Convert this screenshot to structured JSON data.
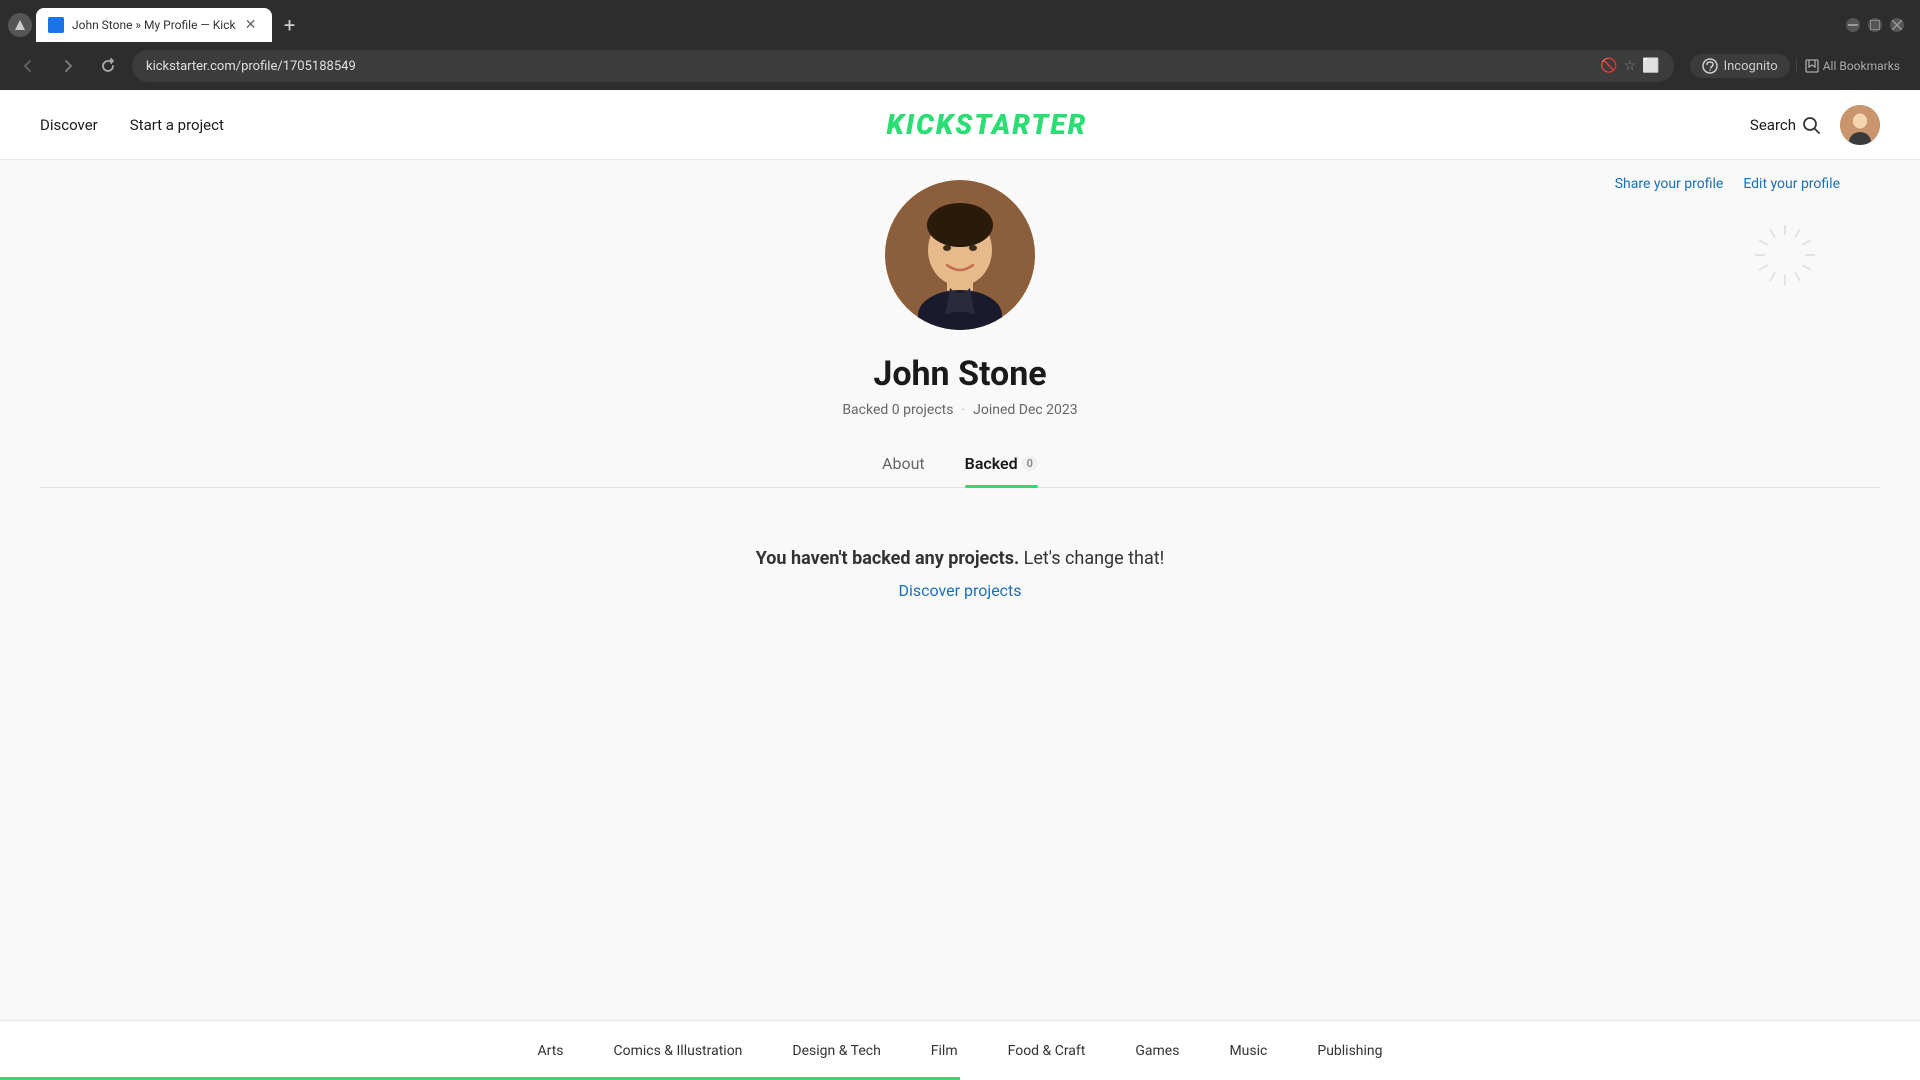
{
  "browser": {
    "tab_title": "John Stone » My Profile — Kick",
    "url": "kickstarter.com/profile/1705188549",
    "new_tab_label": "+",
    "incognito_label": "Incognito",
    "all_bookmarks_label": "All Bookmarks"
  },
  "nav": {
    "discover_label": "Discover",
    "start_project_label": "Start a project",
    "logo_text": "KICKSTARTER",
    "search_label": "Search"
  },
  "profile": {
    "name": "John Stone",
    "meta_backed": "Backed 0 projects",
    "meta_dot": "·",
    "meta_joined": "Joined Dec 2023",
    "share_label": "Share your profile",
    "edit_label": "Edit your profile",
    "tabs": [
      {
        "id": "about",
        "label": "About",
        "badge": null,
        "active": false
      },
      {
        "id": "backed",
        "label": "Backed",
        "badge": "0",
        "active": true
      }
    ],
    "no_backed_strong": "You haven't backed any projects.",
    "no_backed_rest": " Let's change that!",
    "discover_link": "Discover projects"
  },
  "footer": {
    "categories": [
      {
        "id": "arts",
        "label": "Arts"
      },
      {
        "id": "comics",
        "label": "Comics & Illustration"
      },
      {
        "id": "design",
        "label": "Design & Tech"
      },
      {
        "id": "film",
        "label": "Film"
      },
      {
        "id": "food",
        "label": "Food & Craft"
      },
      {
        "id": "games",
        "label": "Games"
      },
      {
        "id": "music",
        "label": "Music"
      },
      {
        "id": "publishing",
        "label": "Publishing"
      }
    ]
  }
}
